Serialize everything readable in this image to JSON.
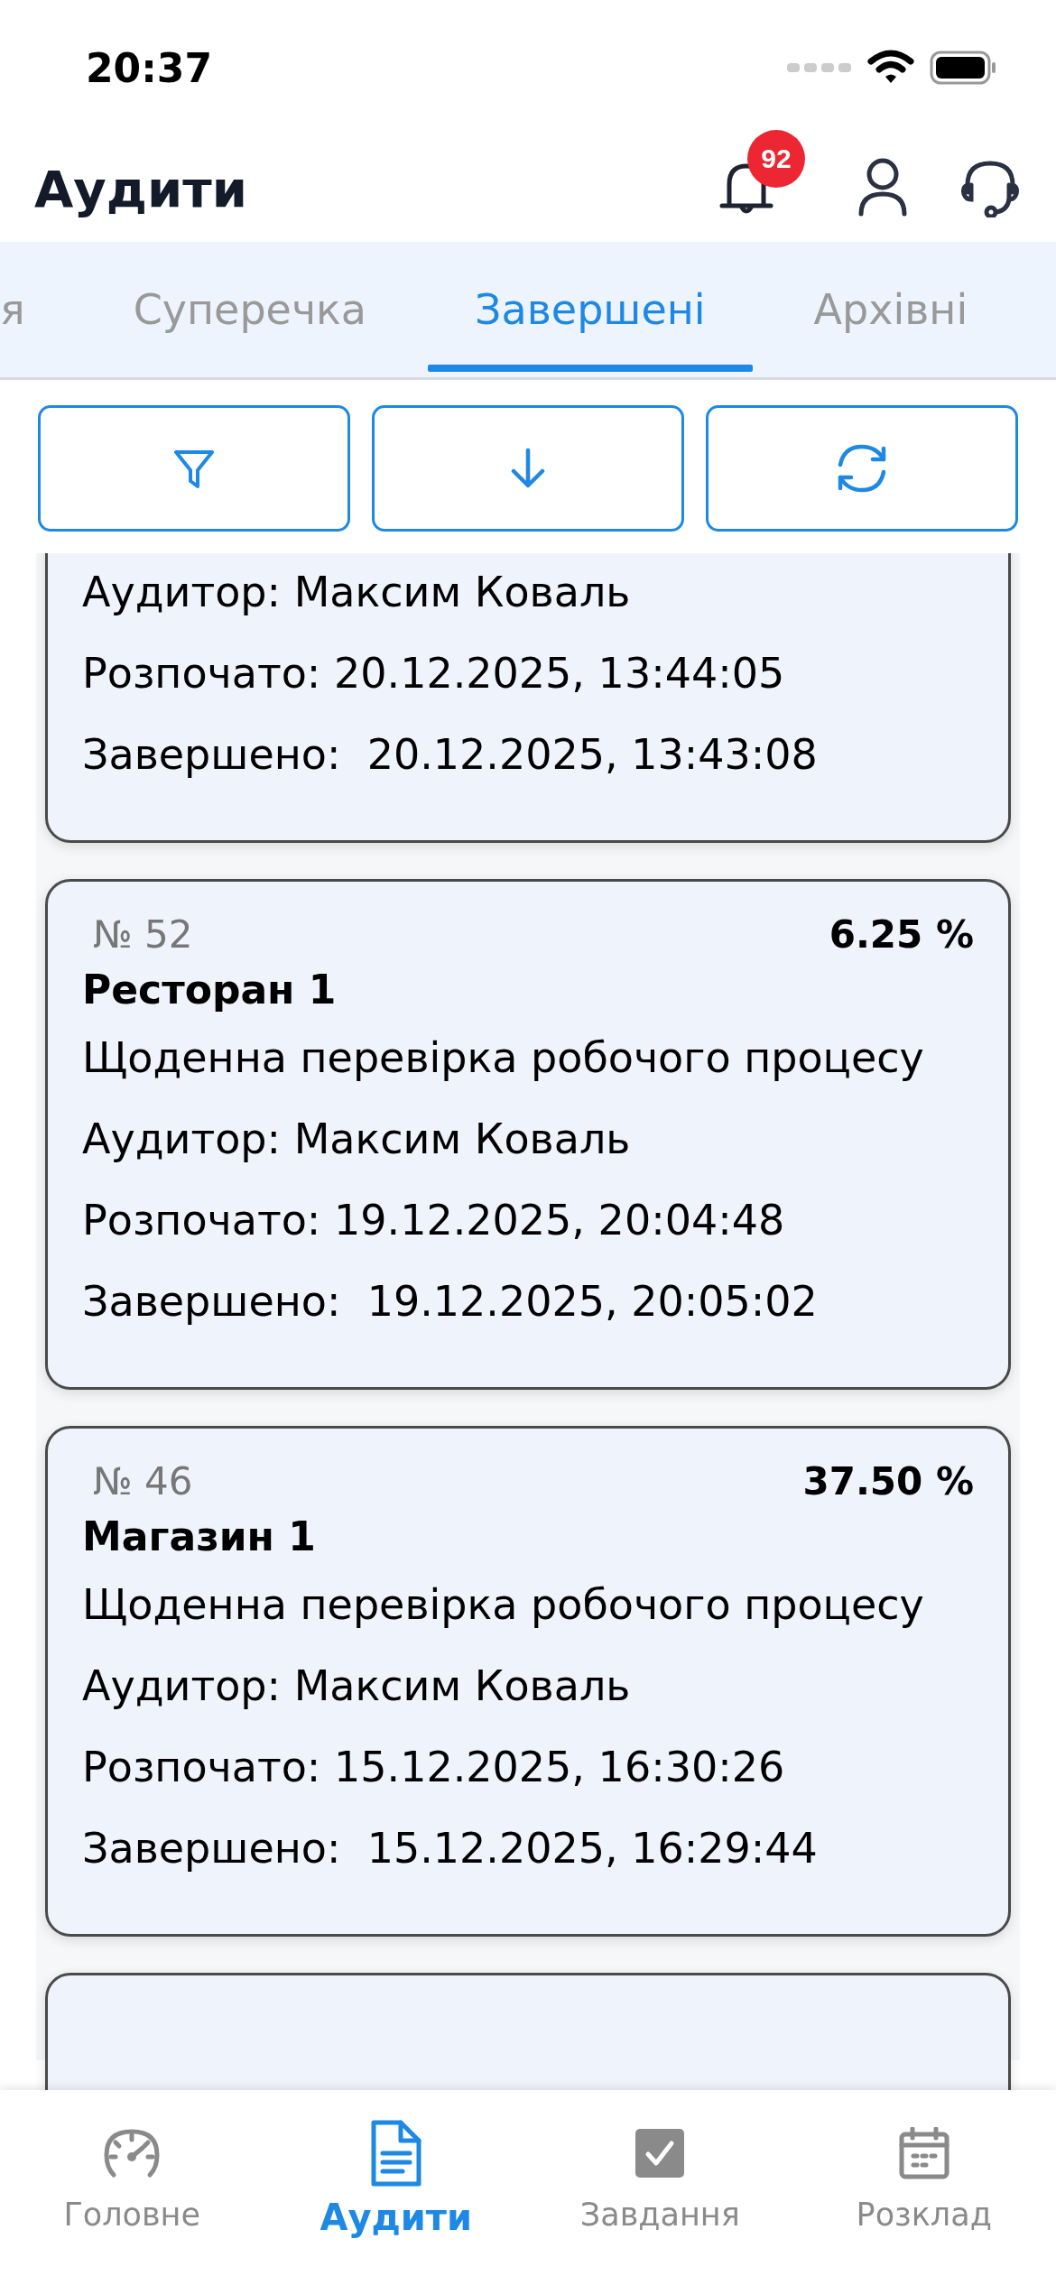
{
  "status_bar": {
    "time": "20:37"
  },
  "header": {
    "title": "Аудити",
    "notifications_badge": "92"
  },
  "tabs": [
    {
      "label": "я",
      "selected": false
    },
    {
      "label": "Суперечка",
      "selected": false
    },
    {
      "label": "Завершені",
      "selected": true
    },
    {
      "label": "Архівні",
      "selected": false
    }
  ],
  "audits": [
    {
      "kind": "audit",
      "auditor": "Аудитор: Максим Коваль",
      "started": "Розпочато: 20.12.2025, 13:44:05",
      "finished": "Завершено:  20.12.2025, 13:43:08"
    },
    {
      "kind": "audit",
      "number": "№ 52",
      "score": "6.25 %",
      "name": "Ресторан 1",
      "description": "Щоденна перевірка робочого процесу",
      "auditor": "Аудитор: Максим Коваль",
      "started": "Розпочато: 19.12.2025, 20:04:48",
      "finished": "Завершено:  19.12.2025, 20:05:02"
    },
    {
      "kind": "audit",
      "number": "№ 46",
      "score": "37.50 %",
      "name": "Магазин 1",
      "description": "Щоденна перевірка робочого процесу",
      "auditor": "Аудитор: Максим Коваль",
      "started": "Розпочато: 15.12.2025, 16:30:26",
      "finished": "Завершено:  15.12.2025, 16:29:44"
    },
    {
      "kind": "audit"
    }
  ],
  "bottom_nav": [
    {
      "label": "Головне",
      "selected": false
    },
    {
      "label": "Аудити",
      "selected": true
    },
    {
      "label": "Завдання",
      "selected": false
    },
    {
      "label": "Розклад",
      "selected": false
    }
  ]
}
